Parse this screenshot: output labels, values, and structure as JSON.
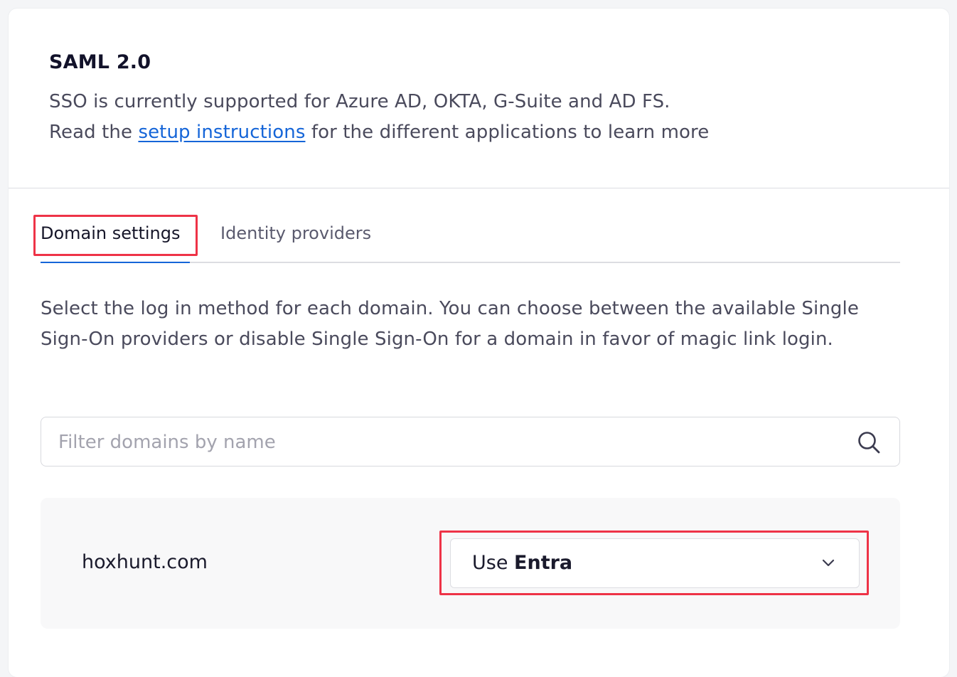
{
  "header": {
    "title": "SAML 2.0",
    "line1": "SSO is currently supported for Azure AD, OKTA, G-Suite and AD FS.",
    "line2_prefix": "Read the ",
    "link_text": "setup instructions",
    "line2_suffix": " for the different applications to learn more"
  },
  "tabs": [
    {
      "label": "Domain settings",
      "active": true
    },
    {
      "label": "Identity providers",
      "active": false
    }
  ],
  "intro_text": "Select the log in method for each domain. You can choose between the available Single Sign-On providers or disable Single Sign-On for a domain in favor of magic link login.",
  "search": {
    "placeholder": "Filter domains by name",
    "value": "",
    "icon": "search-icon"
  },
  "domains": [
    {
      "name": "hoxhunt.com",
      "method_prefix": "Use ",
      "method_value": "Entra",
      "icon": "chevron-down-icon"
    }
  ],
  "colors": {
    "accent": "#1565d8",
    "highlight": "#ee3347"
  }
}
